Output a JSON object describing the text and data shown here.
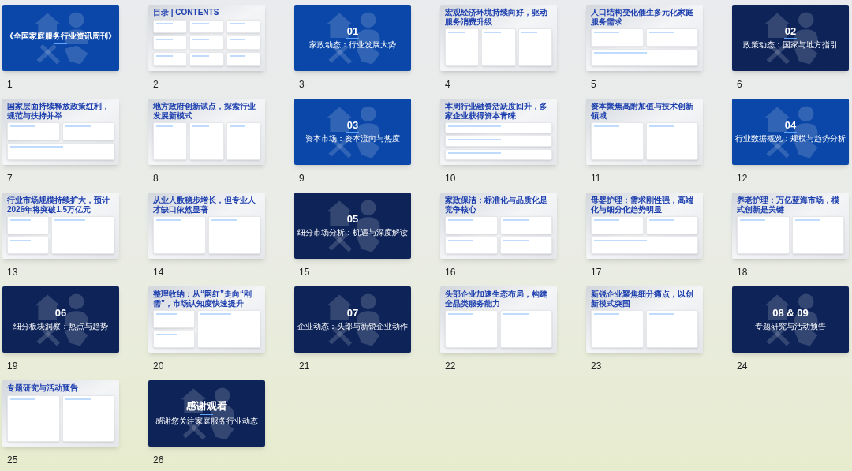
{
  "slides": [
    {
      "number": "1",
      "kind": "cover",
      "color": "#0b47a8",
      "title": "《全国家庭服务行业资讯周刊》"
    },
    {
      "number": "2",
      "kind": "toc",
      "title": "目录 | CONTENTS"
    },
    {
      "number": "3",
      "kind": "section",
      "color": "#0b47a8",
      "section": "01",
      "title": "家政动态：行业发展大势"
    },
    {
      "number": "4",
      "kind": "three",
      "title": "宏观经济环境持续向好，驱动服务消费升级"
    },
    {
      "number": "5",
      "kind": "twotop",
      "title": "人口结构变化催生多元化家庭服务需求"
    },
    {
      "number": "6",
      "kind": "section",
      "color": "#0e2459",
      "section": "02",
      "title": "政策动态：国家与地方指引"
    },
    {
      "number": "7",
      "kind": "twotop",
      "title": "国家层面持续释放政策红利，规范与扶持并举"
    },
    {
      "number": "8",
      "kind": "three",
      "title": "地方政府创新试点，探索行业发展新模式"
    },
    {
      "number": "9",
      "kind": "section",
      "color": "#0b47a8",
      "section": "03",
      "title": "资本市场：资本流向与热度"
    },
    {
      "number": "10",
      "kind": "list",
      "title": "本周行业融资活跃度回升，多家企业获得资本青睐"
    },
    {
      "number": "11",
      "kind": "two",
      "title": "资本聚焦高附加值与技术创新领域"
    },
    {
      "number": "12",
      "kind": "section",
      "color": "#0b47a8",
      "section": "04",
      "title": "行业数据概览：规模与趋势分析"
    },
    {
      "number": "13",
      "kind": "split",
      "title": "行业市场规模持续扩大，预计2026年将突破1.5万亿元"
    },
    {
      "number": "14",
      "kind": "two",
      "title": "从业人数稳步增长，但专业人才缺口依然显著"
    },
    {
      "number": "15",
      "kind": "section",
      "color": "#0e2459",
      "section": "05",
      "title": "细分市场分析：机遇与深度解读"
    },
    {
      "number": "16",
      "kind": "four",
      "title": "家政保洁：标准化与品质化是竞争核心"
    },
    {
      "number": "17",
      "kind": "twotop",
      "title": "母婴护理：需求刚性强，高端化与细分化趋势明显"
    },
    {
      "number": "18",
      "kind": "two",
      "title": "养老护理：万亿蓝海市场，模式创新是关键"
    },
    {
      "number": "19",
      "kind": "section",
      "color": "#0e2459",
      "section": "06",
      "title": "细分板块洞察：热点与趋势"
    },
    {
      "number": "20",
      "kind": "split",
      "title": "整理收纳：从“网红”走向“刚需”，市场认知度快速提升"
    },
    {
      "number": "21",
      "kind": "section",
      "color": "#0e2459",
      "section": "07",
      "title": "企业动态：头部与新锐企业动作"
    },
    {
      "number": "22",
      "kind": "two",
      "title": "头部企业加速生态布局，构建全品类服务能力"
    },
    {
      "number": "23",
      "kind": "two",
      "title": "新锐企业聚焦细分痛点，以创新模式突围"
    },
    {
      "number": "24",
      "kind": "section",
      "color": "#0e2459",
      "section": "08 & 09",
      "title": "专题研究与活动预告"
    },
    {
      "number": "25",
      "kind": "two",
      "title": "专题研究与活动预告"
    },
    {
      "number": "26",
      "kind": "end",
      "color": "#0e2459",
      "title": "感谢观看",
      "subtitle": "感谢您关注家庭服务行业动态"
    }
  ]
}
